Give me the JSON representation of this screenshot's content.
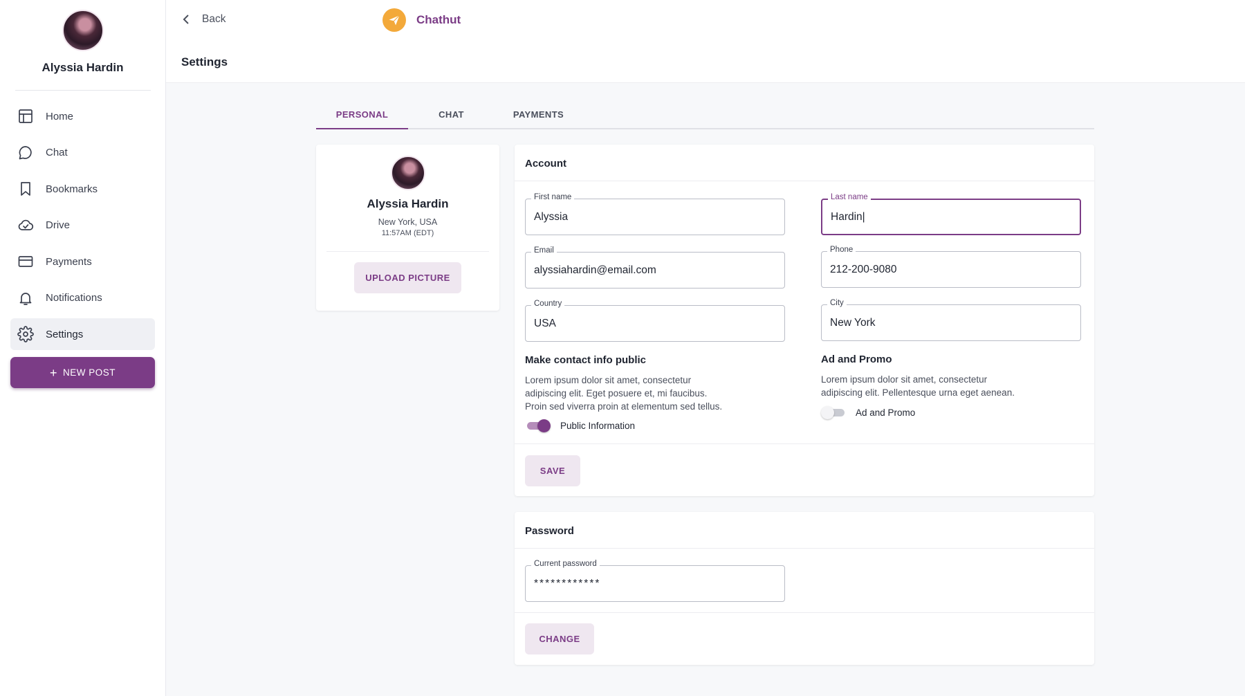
{
  "sidebar": {
    "user_name": "Alyssia Hardin",
    "nav": [
      {
        "label": "Home",
        "icon": "home-icon"
      },
      {
        "label": "Chat",
        "icon": "chat-icon"
      },
      {
        "label": "Bookmarks",
        "icon": "bookmark-icon"
      },
      {
        "label": "Drive",
        "icon": "cloud-icon"
      },
      {
        "label": "Payments",
        "icon": "credit-card-icon"
      },
      {
        "label": "Notifications",
        "icon": "bell-icon"
      },
      {
        "label": "Settings",
        "icon": "gear-icon",
        "active": true
      }
    ],
    "new_post_label": "NEW POST",
    "new_post_icon": "+"
  },
  "topbar": {
    "back_label": "Back",
    "brand_name": "Chathut",
    "page_title": "Settings"
  },
  "tabs": [
    {
      "label": "PERSONAL",
      "active": true
    },
    {
      "label": "CHAT",
      "active": false
    },
    {
      "label": "PAYMENTS",
      "active": false
    }
  ],
  "profile_card": {
    "name": "Alyssia Hardin",
    "location": "New York, USA",
    "time": "11:57AM (EDT)",
    "upload_label": "UPLOAD PICTURE"
  },
  "account": {
    "title": "Account",
    "fields": {
      "first_name": {
        "label": "First name",
        "value": "Alyssia"
      },
      "last_name": {
        "label": "Last name",
        "value": "Hardin|"
      },
      "email": {
        "label": "Email",
        "value": "alyssiahardin@email.com"
      },
      "phone": {
        "label": "Phone",
        "value": "212-200-9080"
      },
      "country": {
        "label": "Country",
        "value": "USA"
      },
      "city": {
        "label": "City",
        "value": "New York"
      }
    },
    "contact_public": {
      "title": "Make contact info public",
      "desc_lines": [
        "Lorem ipsum dolor sit amet, consectetur",
        "adipiscing elit. Eget posuere et, mi faucibus.",
        "Proin sed viverra proin at elementum sed tellus."
      ],
      "toggle_label": "Public Information",
      "toggle_on": true
    },
    "ad_promo": {
      "title": "Ad and Promo",
      "desc_lines": [
        "Lorem ipsum dolor sit amet, consectetur",
        "adipiscing elit. Pellentesque urna eget aenean."
      ],
      "toggle_label": "Ad and Promo",
      "toggle_on": false
    },
    "save_label": "SAVE"
  },
  "password": {
    "title": "Password",
    "current_label": "Current password",
    "current_value": "************",
    "change_label": "CHANGE"
  },
  "colors": {
    "accent": "#7b3c86",
    "brand_logo": "#f3a93a",
    "soft_button_bg": "#efe7f0"
  }
}
